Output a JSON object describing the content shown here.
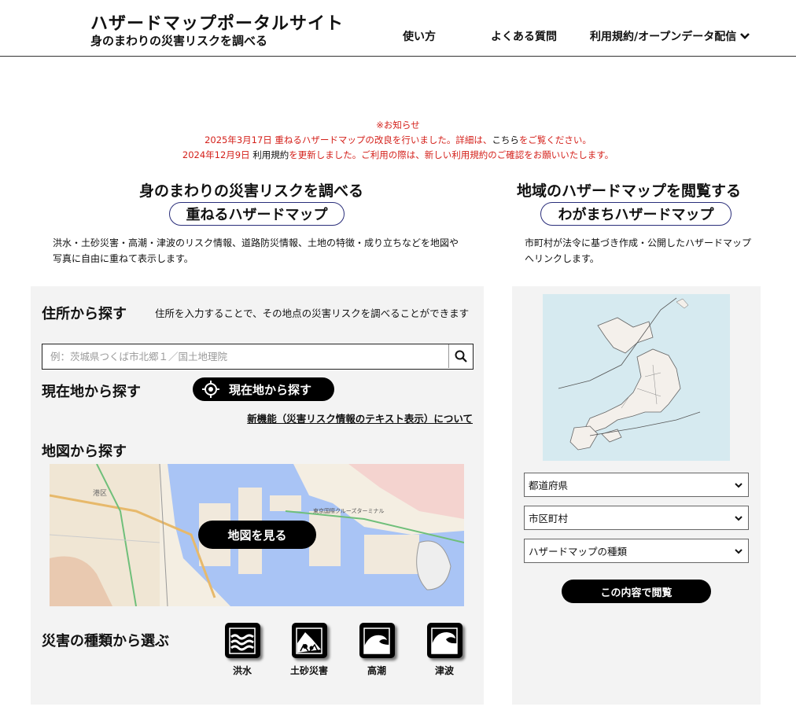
{
  "header": {
    "title": "ハザードマップポータルサイト",
    "subtitle": "身のまわりの災害リスクを調べる",
    "nav": {
      "howto": "使い方",
      "faq": "よくある質問",
      "terms": "利用規約/オープンデータ配信"
    }
  },
  "notice": {
    "heading": "※お知らせ",
    "line1_pre": "2025年3月17日  重ねるハザードマップの改良を行いました。詳細は、",
    "line1_link": "こちら",
    "line1_post": "をご覧ください。",
    "line2_pre": "2024年12月9日  ",
    "line2_link": "利用規約",
    "line2_post": "を更新しました。ご利用の際は、新しい利用規約のご確認をお願いいたします。"
  },
  "left_section": {
    "heading": "身のまわりの災害リスクを調べる",
    "pill": "重ねるハザードマップ",
    "description": "洪水・土砂災害・高潮・津波のリスク情報、道路防災情報、土地の特徴・成り立ちなどを地図や写真に自由に重ねて表示します。"
  },
  "right_section": {
    "heading": "地域のハザードマップを閲覧する",
    "pill": "わがまちハザードマップ",
    "description": "市町村が法令に基づき作成・公開したハザードマップへリンクします。"
  },
  "address_search": {
    "title": "住所から探す",
    "description": "住所を入力することで、その地点の災害リスクを調べることができます",
    "placeholder": "例：茨城県つくば市北郷１／国土地理院"
  },
  "current_location": {
    "title": "現在地から探す",
    "button": "現在地から探す",
    "new_feature_link": "新機能（災害リスク情報のテキスト表示）について"
  },
  "map_search": {
    "title": "地図から探す",
    "button": "地図を見る",
    "map_labels": {
      "a": "港区",
      "b": "東京国際クルーズターミナル"
    }
  },
  "hazard_types": {
    "title": "災害の種類から選ぶ",
    "items": [
      {
        "label": "洪水",
        "icon": "flood-icon"
      },
      {
        "label": "土砂災害",
        "icon": "landslide-icon"
      },
      {
        "label": "高潮",
        "icon": "storm-surge-icon"
      },
      {
        "label": "津波",
        "icon": "tsunami-icon"
      }
    ]
  },
  "local_map": {
    "selects": {
      "prefecture": "都道府県",
      "municipality": "市区町村",
      "map_type": "ハザードマップの種類"
    },
    "button": "この内容で閲覧"
  },
  "colors": {
    "notice_red": "#d4211b",
    "pill_border": "#2a2e7a",
    "panel_bg": "#f3f3f3",
    "sea_blue": "#d6eaf0"
  }
}
